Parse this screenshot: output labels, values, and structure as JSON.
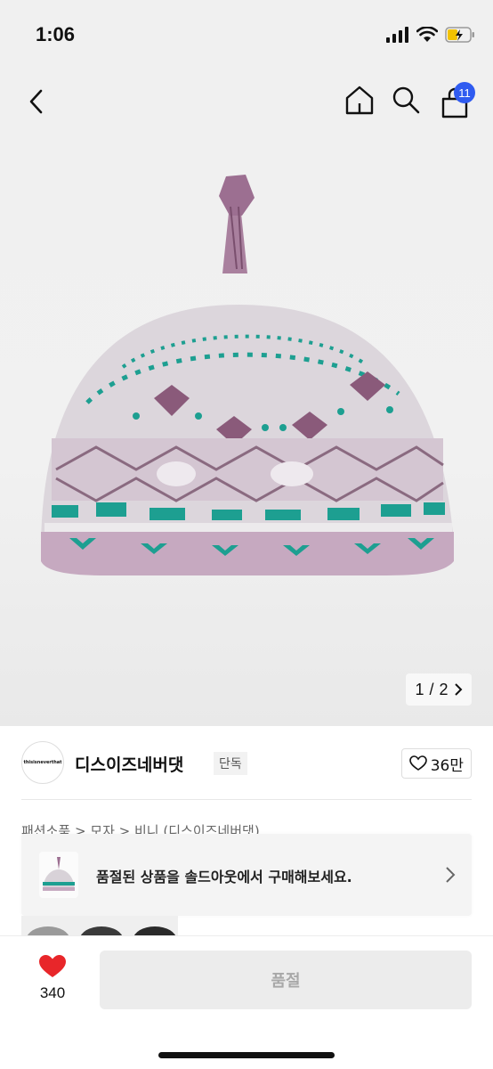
{
  "status_bar": {
    "time": "1:06"
  },
  "header": {
    "cart_count": "11"
  },
  "gallery": {
    "current": "1",
    "separator": "/",
    "total": "2"
  },
  "brand": {
    "logo_text": "thisisneverthat",
    "name": "디스이즈네버댓",
    "tag": "단독",
    "likes": "36만"
  },
  "breadcrumb": "패션소품 > 모자 > 비니 (디스이즈네버댓)",
  "soldout_banner": {
    "text": "품절된 상품을 솔드아웃에서 구매해보세요."
  },
  "bottom": {
    "wish_count": "340",
    "buy_label": "품절"
  },
  "colors": {
    "accent": "#2f5bf0",
    "heart": "#e8262a",
    "hat_base": "#d8d2d8",
    "hat_teal": "#1d9f91",
    "hat_purple": "#8a5a7a"
  }
}
